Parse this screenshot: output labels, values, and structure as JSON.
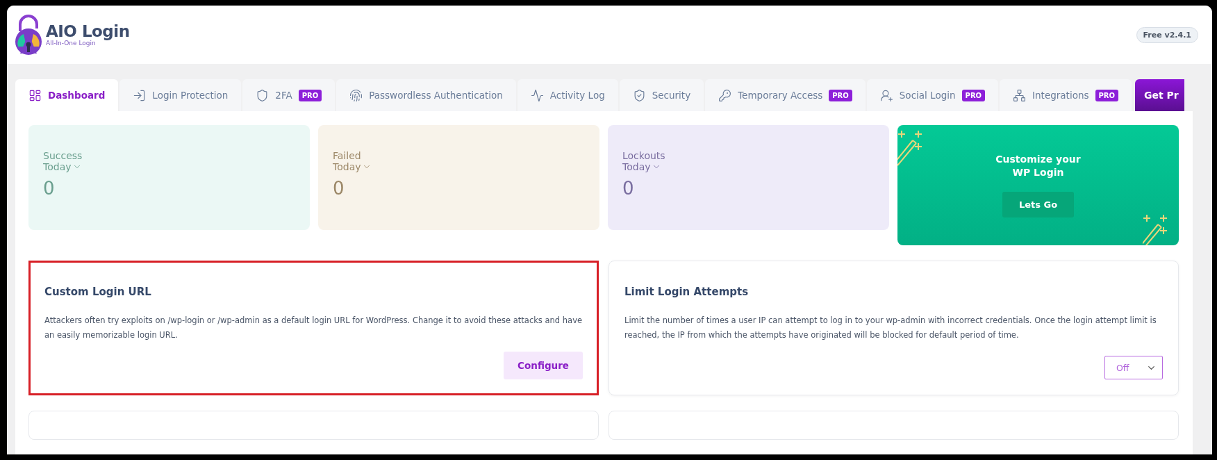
{
  "header": {
    "brand": "AIO Login",
    "tagline": "All-In-One Login",
    "version": "Free v2.4.1"
  },
  "tabs": [
    {
      "label": "Dashboard",
      "selected": true
    },
    {
      "label": "Login Protection",
      "selected": false
    },
    {
      "label": "2FA",
      "selected": false,
      "badge": "PRO"
    },
    {
      "label": "Passwordless Authentication",
      "selected": false
    },
    {
      "label": "Activity Log",
      "selected": false
    },
    {
      "label": "Security",
      "selected": false
    },
    {
      "label": "Temporary Access",
      "selected": false,
      "badge": "PRO"
    },
    {
      "label": "Social Login",
      "selected": false,
      "badge": "PRO"
    },
    {
      "label": "Integrations",
      "selected": false,
      "badge": "PRO"
    }
  ],
  "get_pro_button": "Get Pr",
  "stats": [
    {
      "label": "Success",
      "period": "Today",
      "value": "0",
      "color": "#ebf8f5"
    },
    {
      "label": "Failed",
      "period": "Today",
      "value": "0",
      "color": "#f8f3ea"
    },
    {
      "label": "Lockouts",
      "period": "Today",
      "value": "0",
      "color": "#eeebf9"
    }
  ],
  "promo": {
    "title_lines": [
      "Customize your",
      "WP Login"
    ],
    "button": "Lets Go"
  },
  "features": [
    {
      "title": "Custom Login URL",
      "description": "Attackers often try exploits on /wp-login or /wp-admin as a default login URL for WordPress. Change it to avoid these attacks and have an easily memorizable login URL.",
      "highlighted": true,
      "kind": "button",
      "action": "Configure"
    },
    {
      "title": "Limit Login Attempts",
      "description": "Limit the number of times a user IP can attempt to log in to your wp-admin with incorrect credentials. Once the login attempt limit is reached, the IP from which the attempts have originated will be blocked for default period of time.",
      "highlighted": false,
      "kind": "select",
      "action": "Off"
    }
  ]
}
